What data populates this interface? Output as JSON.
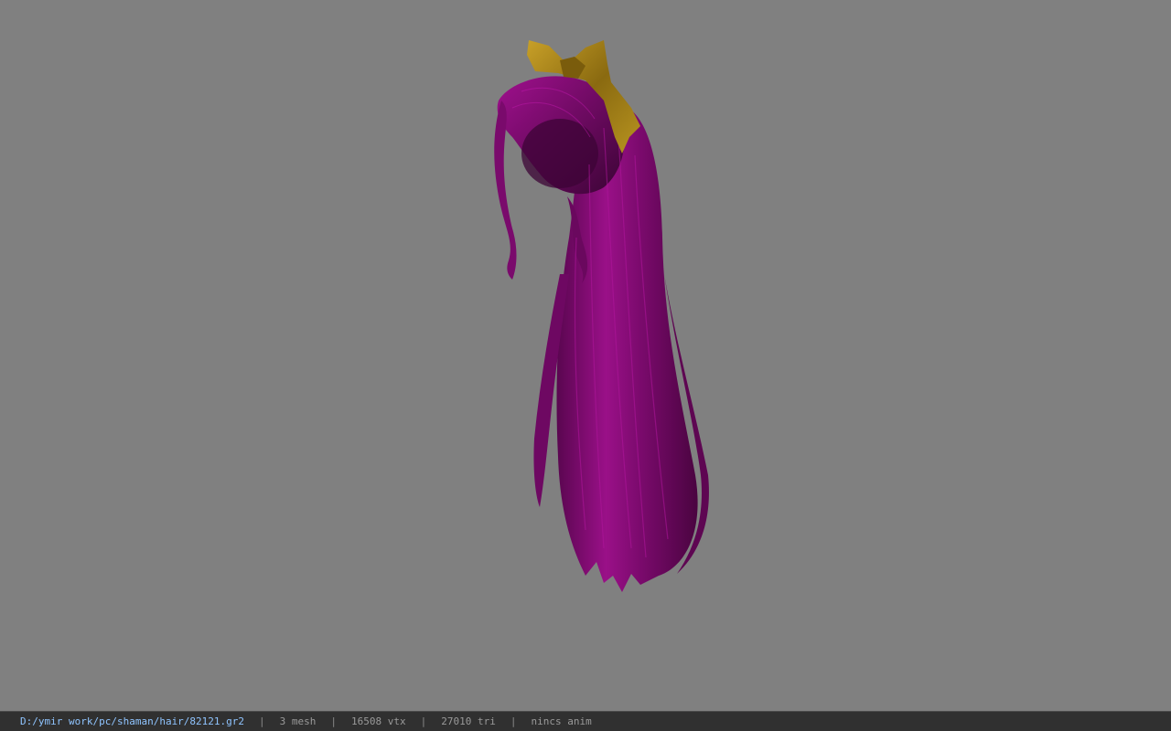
{
  "status_bar": {
    "file_path": "D:/ymir work/pc/shaman/hair/82121.gr2",
    "separator": "|",
    "mesh_count": "3 mesh",
    "vertex_count": "16508 vtx",
    "triangle_count": "27010 tri",
    "anim_status": "nincs anim"
  },
  "colors": {
    "background": "#808080",
    "hair": "#8a0a78",
    "ribbon": "#b08a1c",
    "status_bar": "#303030",
    "path_text": "#8fc4ff"
  },
  "icons": {
    "model": "hair-model-render"
  }
}
